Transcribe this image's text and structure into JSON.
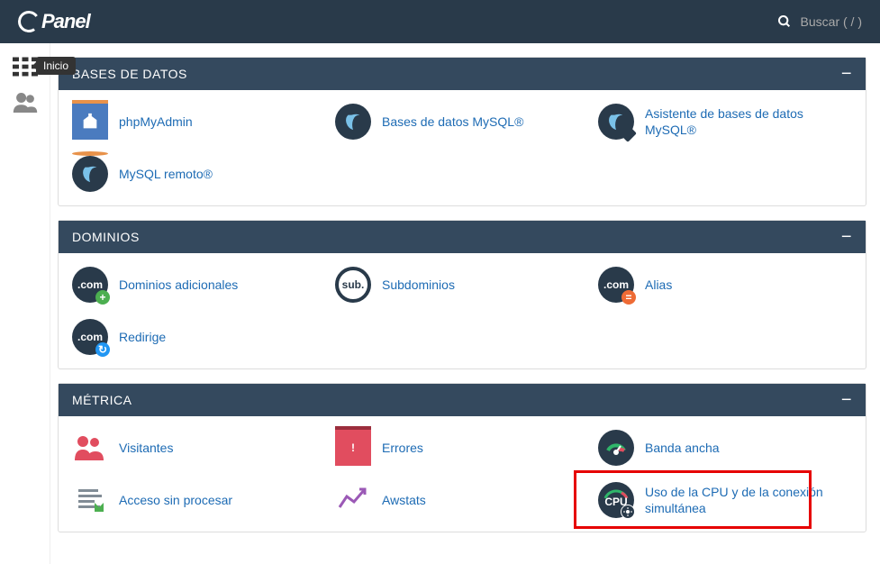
{
  "topbar": {
    "logo_text": "Panel",
    "search_placeholder": "Buscar ( / )"
  },
  "sidebar": {
    "tooltip": "Inicio"
  },
  "panels": {
    "databases": {
      "title": "BASES DE DATOS",
      "items": {
        "phpmyadmin": "phpMyAdmin",
        "mysql": "Bases de datos MySQL®",
        "wizard": "Asistente de bases de datos MySQL®",
        "remote": "MySQL remoto®"
      }
    },
    "domains": {
      "title": "DOMINIOS",
      "dom_label": ".com",
      "sub_label": "sub.",
      "items": {
        "addon": "Dominios adicionales",
        "sub": "Subdominios",
        "alias": "Alias",
        "redirect": "Redirige"
      }
    },
    "metrics": {
      "title": "MÉTRICA",
      "cpu_label": "CPU",
      "items": {
        "visitors": "Visitantes",
        "errors": "Errores",
        "bandwidth": "Banda ancha",
        "rawaccess": "Acceso sin procesar",
        "awstats": "Awstats",
        "cpu": "Uso de la CPU y de la conexión simultánea"
      }
    }
  }
}
